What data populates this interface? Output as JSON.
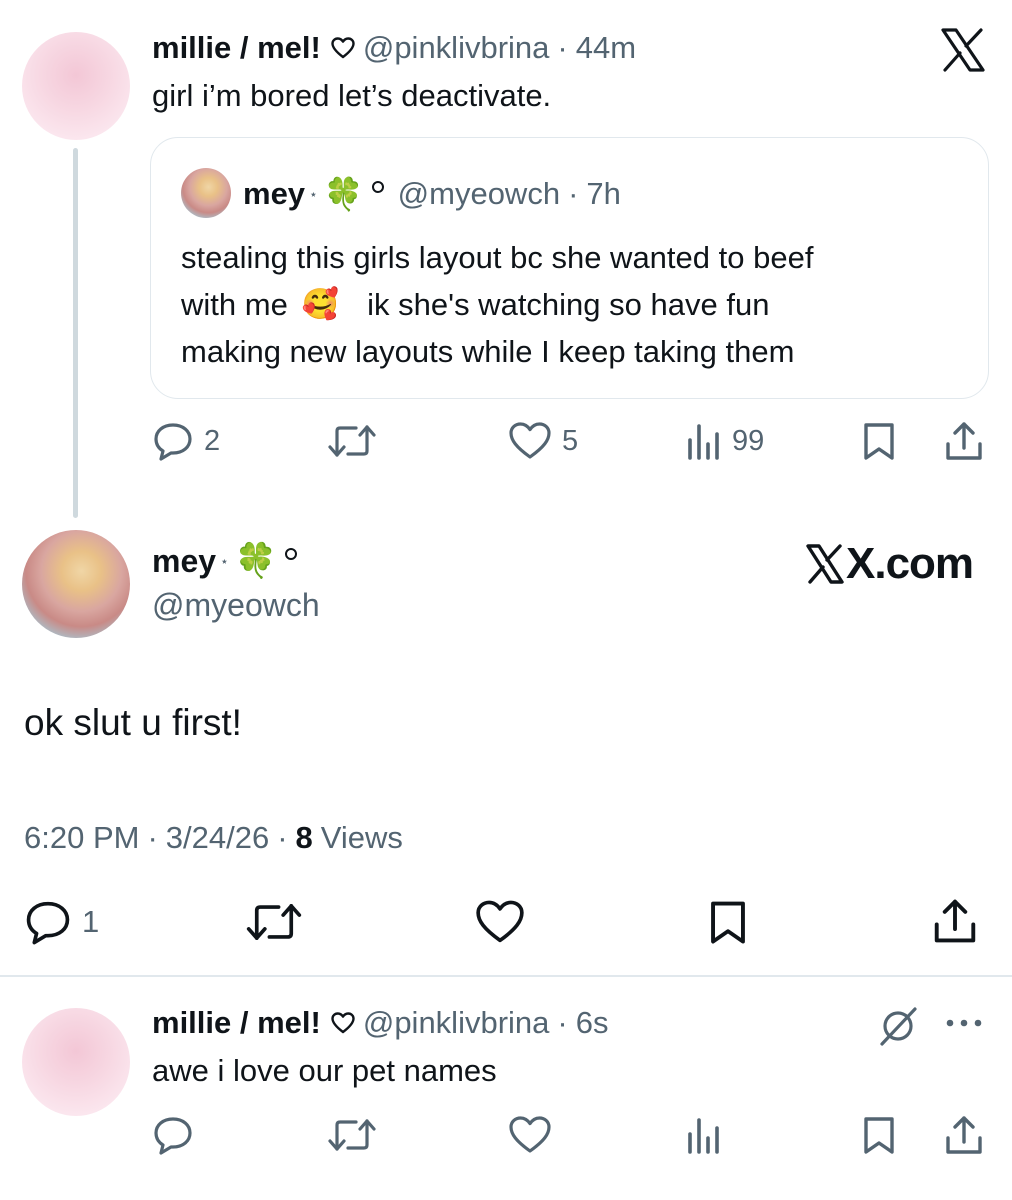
{
  "reply_top": {
    "display_name": "millie / mel!",
    "handle": "@pinklivbrina",
    "time": "44m",
    "text": "girl i’m bored let’s deactivate.",
    "quote": {
      "display_name": "mey",
      "emoji": "🍀",
      "handle": "@myeowch",
      "time": "7h",
      "line1": "stealing this girls layout bc she wanted to beef",
      "line2a": "with me",
      "line2_emoji": "🥰",
      "line2b": "ik she's watching so have fun",
      "line3": "making new layouts while I keep taking them"
    },
    "actions": {
      "replies": "2",
      "likes": "5",
      "views": "99"
    }
  },
  "main_post": {
    "display_name": "mey",
    "emoji": "🍀",
    "handle": "@myeowch",
    "brand": "X.com",
    "text": "ok slut u first!",
    "time": "6:20 PM",
    "date": "3/24/26",
    "views_count": "8",
    "views_label": "Views",
    "actions": {
      "replies": "1"
    }
  },
  "reply_bottom": {
    "display_name": "millie / mel!",
    "handle": "@pinklivbrina",
    "time": "6s",
    "text": "awe i love our pet names"
  },
  "colors": {
    "text": "#0f1419",
    "muted": "#536471",
    "border": "#e1e8ed",
    "thread_line": "#cfd9de"
  },
  "icons": [
    "x-logo-icon",
    "heart-icon",
    "reply-icon",
    "retweet-icon",
    "like-icon",
    "views-icon",
    "bookmark-icon",
    "share-icon",
    "grok-icon",
    "more-icon"
  ]
}
